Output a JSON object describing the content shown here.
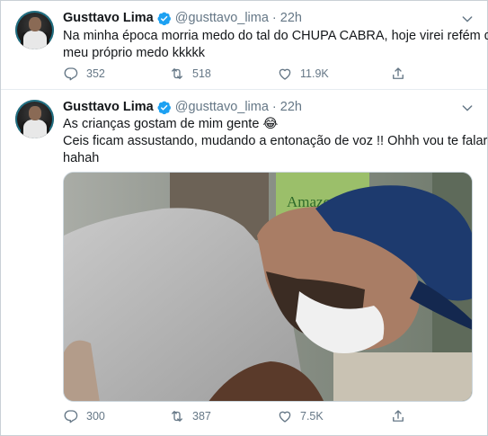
{
  "tweets": [
    {
      "name": "Gusttavo Lima",
      "handle": "@gusttavo_lima",
      "separator": "·",
      "time": "22h",
      "lines": [
        "Na minha época morria medo do tal do CHUPA CABRA, hoje virei refém do",
        "meu próprio medo kkkkk"
      ],
      "replies": "352",
      "retweets": "518",
      "likes": "11.9K"
    },
    {
      "name": "Gusttavo Lima",
      "handle": "@gusttavo_lima",
      "separator": "·",
      "time": "22h",
      "lines": [
        "As crianças gostam de mim gente 😂",
        "Ceis ficam assustando, mudando a entonação de voz !! Ohhh vou te falar",
        "hahah"
      ],
      "media_sign_text": "Amazonas",
      "replies": "300",
      "retweets": "387",
      "likes": "7.5K"
    }
  ],
  "icons": {
    "verified": "verified-badge-icon",
    "caret": "chevron-down-icon",
    "reply": "reply-icon",
    "retweet": "retweet-icon",
    "like": "heart-icon",
    "share": "share-icon"
  },
  "colors": {
    "verified_blue": "#1da1f2",
    "muted_text": "#657786",
    "text": "#14171a",
    "border": "#e6ecf0"
  }
}
